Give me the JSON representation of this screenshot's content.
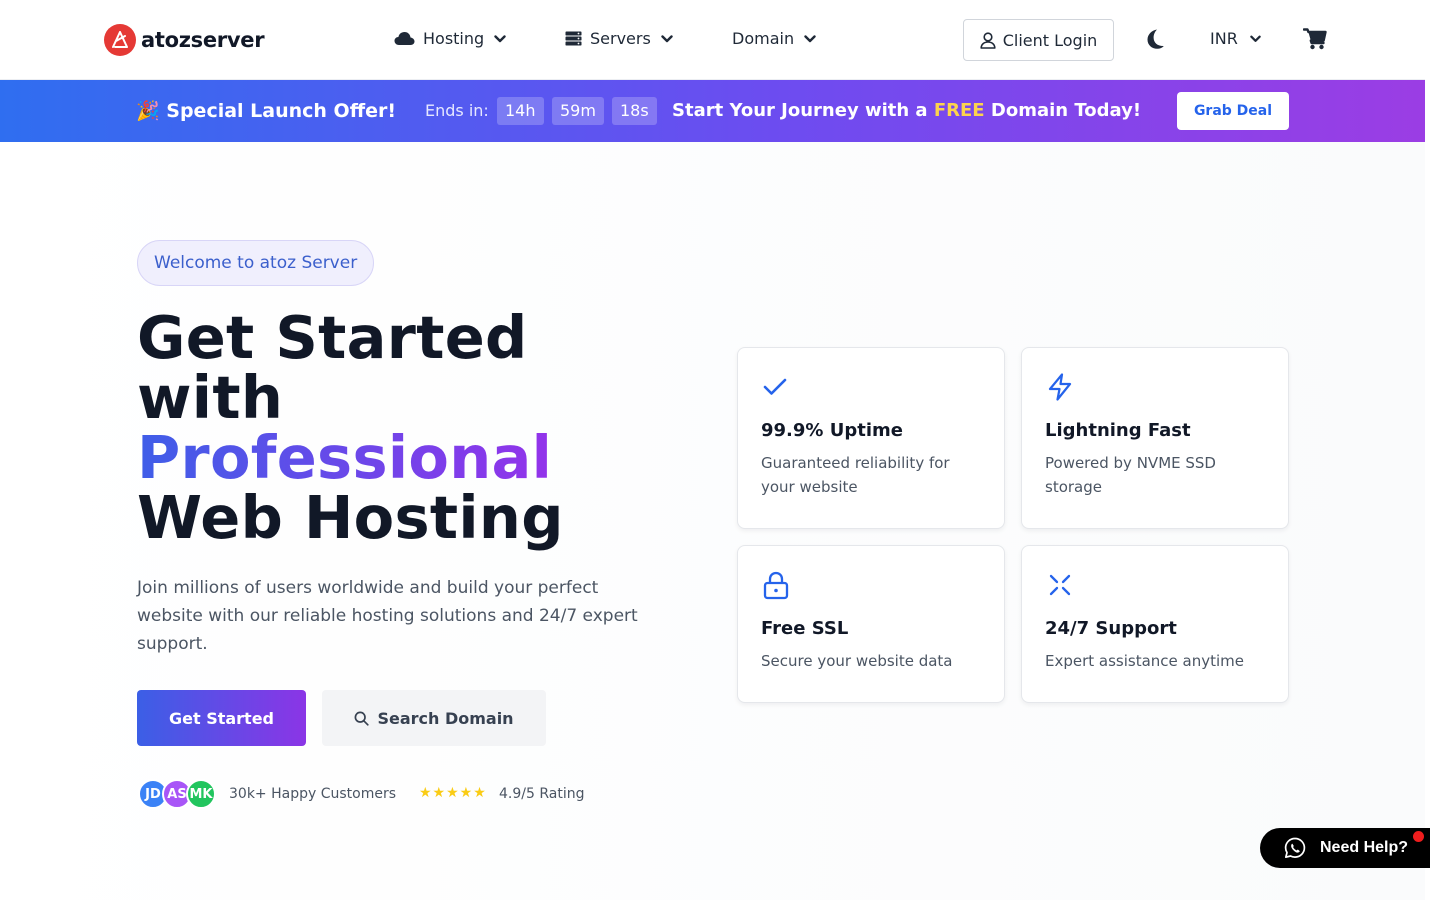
{
  "nav": {
    "logo_text": "atozserver",
    "items": [
      {
        "label": "Hosting"
      },
      {
        "label": "Servers"
      },
      {
        "label": "Domain"
      }
    ],
    "login_label": "Client Login",
    "currency": "INR"
  },
  "promo": {
    "title": "🎉 Special Launch Offer!",
    "ends_label": "Ends in:",
    "timer": {
      "hours": "14h",
      "minutes": "59m",
      "seconds": "18s"
    },
    "msg_before": "Start Your Journey with a",
    "msg_highlight": "FREE",
    "msg_after": "Domain Today!",
    "cta": "Grab Deal"
  },
  "hero": {
    "badge": "Welcome to atoz Server",
    "headline_line1": "Get Started",
    "headline_line2": "with",
    "headline_gradient": "Professional",
    "headline_line4": "Web Hosting",
    "subtitle": "Join millions of users worldwide and build your perfect website with our reliable hosting solutions and 24/7 expert support.",
    "primary_cta": "Get Started",
    "secondary_cta": "Search Domain",
    "avatars": [
      {
        "initials": "JD",
        "color": "#3b82f6"
      },
      {
        "initials": "AS",
        "color": "#a855f7"
      },
      {
        "initials": "MK",
        "color": "#22c55e"
      }
    ],
    "customers": "30k+ Happy Customers",
    "stars": "★★★★★",
    "rating": "4.9/5 Rating"
  },
  "features": [
    {
      "title": "99.9% Uptime",
      "desc": "Guaranteed reliability for your website",
      "icon": "check-icon"
    },
    {
      "title": "Lightning Fast",
      "desc": "Powered by NVME SSD storage",
      "icon": "bolt-icon"
    },
    {
      "title": "Free SSL",
      "desc": "Secure your website data",
      "icon": "lock-icon"
    },
    {
      "title": "24/7 Support",
      "desc": "Expert assistance anytime",
      "icon": "arrows-icon"
    }
  ],
  "help": {
    "label": "Need Help?"
  },
  "colors": {
    "accent": "#2563eb",
    "brand_red": "#e53935",
    "highlight": "#fcd34d"
  }
}
